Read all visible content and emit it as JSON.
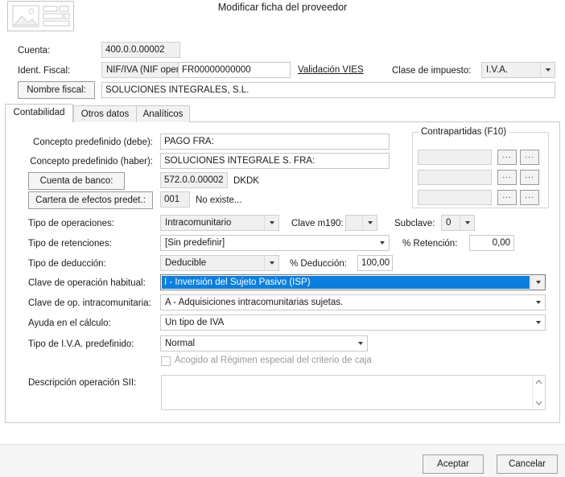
{
  "dialog": {
    "title": "Modificar ficha del proveedor",
    "icon": "form-record-icon"
  },
  "top_form": {
    "cuenta": {
      "label": "Cuenta:",
      "value": "400.0.0.00002"
    },
    "ident_fiscal": {
      "label": "Ident. Fiscal:",
      "type_value": "NIF/IVA (NIF oper",
      "number_value": "FR00000000000"
    },
    "validacion_vies": {
      "label": "Validación VIES"
    },
    "clase_impuesto": {
      "label": "Clase de impuesto:",
      "value": "I.V.A."
    },
    "nombre_fiscal": {
      "label": "Nombre fiscal:",
      "value": "SOLUCIONES INTEGRALES, S.L."
    }
  },
  "tabs": [
    {
      "label": "Contabilidad",
      "active": true
    },
    {
      "label": "Otros datos",
      "active": false
    },
    {
      "label": "Analíticos",
      "active": false
    }
  ],
  "contabilidad": {
    "concepto_debe": {
      "label": "Concepto predefinido (debe):",
      "value": "PAGO FRA:"
    },
    "concepto_haber": {
      "label": "Concepto predefinido (haber):",
      "value": "SOLUCIONES INTEGRALE S. FRA:"
    },
    "cuenta_banco": {
      "label": "Cuenta de banco:",
      "value": "572.0.0.00002",
      "suffix": "DKDK"
    },
    "cartera_efectos": {
      "label": "Cartera de efectos predet.:",
      "value": "001",
      "suffix": "No existe..."
    },
    "tipo_operaciones": {
      "label": "Tipo de operaciones:",
      "value": "Intracomunitario"
    },
    "clave_m190": {
      "label": "Clave m190:",
      "value": ""
    },
    "subclave": {
      "label": "Subclave:",
      "value": "0"
    },
    "tipo_retenciones": {
      "label": "Tipo de retenciones:",
      "value": "[Sin predefinir]"
    },
    "pct_retencion": {
      "label": "% Retención:",
      "value": "0,00"
    },
    "tipo_deduccion": {
      "label": "Tipo de deducción:",
      "value": "Deducible"
    },
    "pct_deduccion": {
      "label": "% Deducción:",
      "value": "100,00"
    },
    "clave_operacion_habitual": {
      "label": "Clave de operación habitual:",
      "value": "I - Inversión del Sujeto Pasivo (ISP)",
      "selected": true,
      "highlight_color": "#0a7fe0"
    },
    "clave_op_intracomunitaria": {
      "label": "Clave de op. intracomunitaria:",
      "value": "A - Adquisiciones intracomunitarias sujetas."
    },
    "ayuda_calculo": {
      "label": "Ayuda en el cálculo:",
      "value": "Un tipo de IVA"
    },
    "tipo_iva_predefinido": {
      "label": "Tipo de I.V.A. predefinido:",
      "value": "Normal"
    },
    "regimen_caja": {
      "label": "Acogido al Régimen especial del criterio de caja",
      "checked": false,
      "disabled": true
    },
    "descripcion_sii": {
      "label": "Descripción operación SII:",
      "value": ""
    }
  },
  "contrapartidas": {
    "title": "Contrapartidas (F10)",
    "rows": [
      {
        "value": "",
        "btn1": "...",
        "btn2": "..."
      },
      {
        "value": "",
        "btn1": "...",
        "btn2": "..."
      },
      {
        "value": "",
        "btn1": "...",
        "btn2": "..."
      }
    ]
  },
  "footer": {
    "accept": "Aceptar",
    "cancel": "Cancelar"
  }
}
